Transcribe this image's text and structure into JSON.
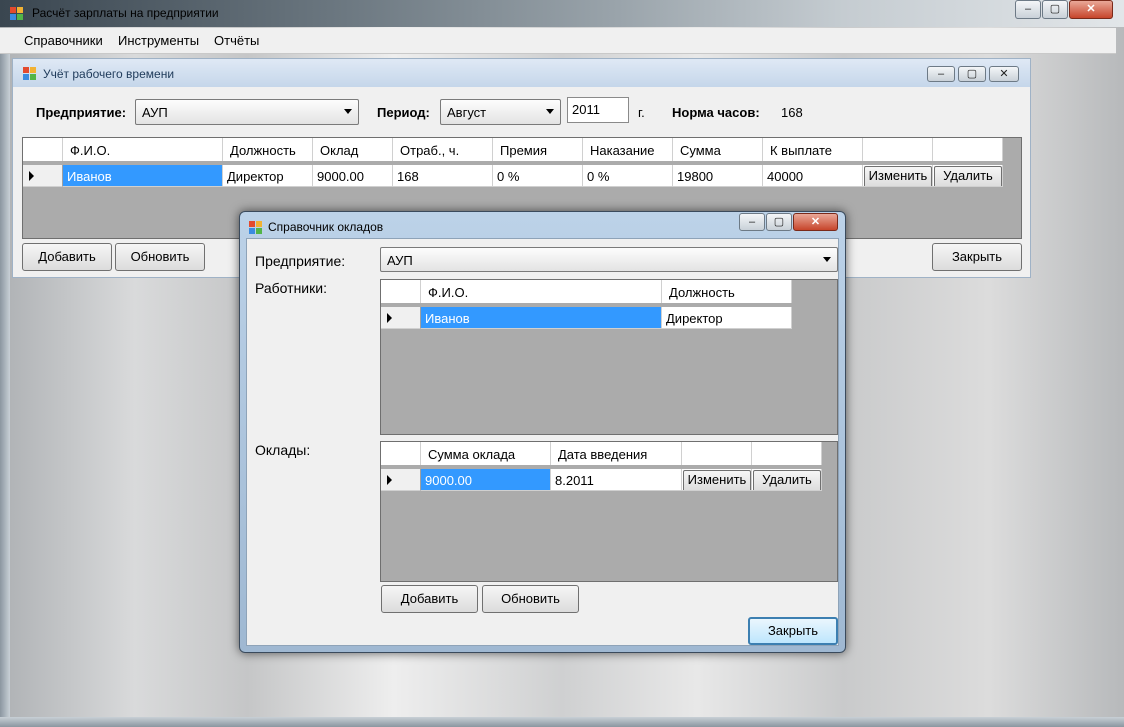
{
  "main_window": {
    "title": "Расчёт зарплаты на предприятии",
    "caption_buttons": {
      "minimize": "–",
      "restore": "▢",
      "close": "✕"
    }
  },
  "menu": {
    "items": [
      "Справочники",
      "Инструменты",
      "Отчёты"
    ]
  },
  "timesheet": {
    "title": "Учёт рабочего времени",
    "enterprise_label": "Предприятие:",
    "enterprise_value": "АУП",
    "period_label": "Период:",
    "period_month": "Август",
    "period_year": "2011",
    "year_suffix": "г.",
    "norm_label": "Норма часов:",
    "norm_value": "168",
    "columns": [
      "Ф.И.О.",
      "Должность",
      "Оклад",
      "Отраб., ч.",
      "Премия",
      "Наказание",
      "Сумма",
      "К выплате"
    ],
    "rows": [
      {
        "fio": "Иванов",
        "position": "Директор",
        "salary": "9000.00",
        "hours": "168",
        "bonus": "0 %",
        "penalty": "0 %",
        "sum": "19800",
        "payout": "40000",
        "edit": "Изменить",
        "delete": "Удалить"
      }
    ],
    "add_button": "Добавить",
    "refresh_button": "Обновить",
    "close_button": "Закрыть"
  },
  "salary_dialog": {
    "title": "Справочник окладов",
    "enterprise_label": "Предприятие:",
    "enterprise_value": "АУП",
    "workers_label": "Работники:",
    "workers_columns": [
      "Ф.И.О.",
      "Должность"
    ],
    "workers_rows": [
      {
        "fio": "Иванов",
        "position": "Директор"
      }
    ],
    "salaries_label": "Оклады:",
    "salaries_columns": [
      "Сумма оклада",
      "Дата введения"
    ],
    "salaries_rows": [
      {
        "amount": "9000.00",
        "date": "8.2011",
        "edit": "Изменить",
        "delete": "Удалить"
      }
    ],
    "add_button": "Добавить",
    "refresh_button": "Обновить",
    "close_button": "Закрыть"
  },
  "colors": {
    "selection": "#3399ff",
    "grid_background": "#ababab",
    "window_face": "#f0f0f0"
  }
}
